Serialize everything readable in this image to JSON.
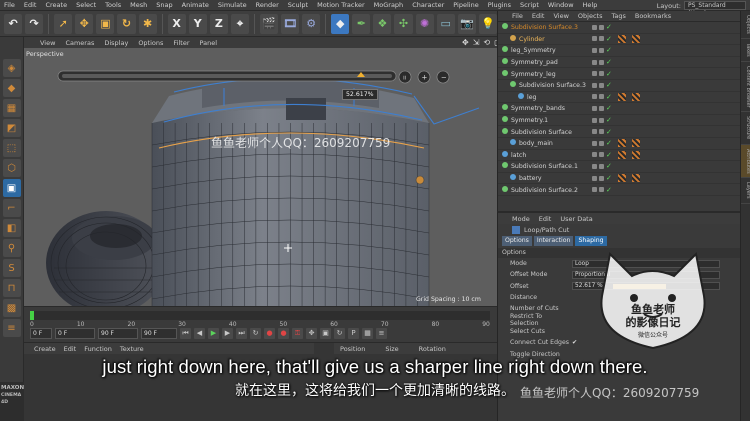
{
  "menubar": {
    "items": [
      "File",
      "Edit",
      "Create",
      "Select",
      "Tools",
      "Mesh",
      "Snap",
      "Animate",
      "Simulate",
      "Render",
      "Sculpt",
      "Motion Tracker",
      "MoGraph",
      "Character",
      "Pipeline",
      "Plugins",
      "Script",
      "Window",
      "Help"
    ],
    "layout_label": "Layout:",
    "layout_value": "PS_Standard (User)"
  },
  "toolbar": {
    "axis_x": "X",
    "axis_y": "Y",
    "axis_z": "Z"
  },
  "viewport": {
    "menu": [
      "View",
      "Cameras",
      "Display",
      "Options",
      "Filter",
      "Panel"
    ],
    "name": "Perspective",
    "zoom_tooltip": "52.617%",
    "grid_spacing": "Grid Spacing : 10 cm"
  },
  "timeline": {
    "ticks": [
      "0",
      "10",
      "20",
      "30",
      "40",
      "50",
      "60",
      "70",
      "80",
      "90"
    ],
    "frame_start": "0 F",
    "frame_current": "0 F",
    "frame_end": "90 F",
    "frame_preview_end": "90 F"
  },
  "bottom": {
    "menu": [
      "Create",
      "Edit",
      "Function",
      "Texture"
    ],
    "coord_headers": [
      "Position",
      "Size",
      "Rotation"
    ]
  },
  "brand": {
    "line1": "MAXON",
    "line2": "CINEMA 4D"
  },
  "object_manager": {
    "menu": [
      "File",
      "Edit",
      "View",
      "Objects",
      "Tags",
      "Bookmarks"
    ],
    "objects": [
      {
        "name": "Subdivision Surface.3",
        "indent": 0,
        "color": "#6fc86f",
        "selected": true,
        "tags": 0
      },
      {
        "name": "Cylinder",
        "indent": 1,
        "color": "#d2a24c",
        "selected": false,
        "tags": 2
      },
      {
        "name": "leg_Symmetry",
        "indent": 0,
        "color": "#6fc86f",
        "selected": false,
        "tags": 0
      },
      {
        "name": "Symmetry_pad",
        "indent": 0,
        "color": "#6fc86f",
        "selected": false,
        "tags": 0
      },
      {
        "name": "Symmetry_leg",
        "indent": 0,
        "color": "#6fc86f",
        "selected": false,
        "tags": 0
      },
      {
        "name": "Subdivision Surface.3",
        "indent": 1,
        "color": "#6fc86f",
        "selected": false,
        "tags": 0
      },
      {
        "name": "leg",
        "indent": 2,
        "color": "#5aa0d8",
        "selected": false,
        "tags": 2
      },
      {
        "name": "Symmetry_bands",
        "indent": 0,
        "color": "#6fc86f",
        "selected": false,
        "tags": 0
      },
      {
        "name": "Symmetry.1",
        "indent": 0,
        "color": "#6fc86f",
        "selected": false,
        "tags": 0
      },
      {
        "name": "Subdivision Surface",
        "indent": 0,
        "color": "#6fc86f",
        "selected": false,
        "tags": 0
      },
      {
        "name": "body_main",
        "indent": 1,
        "color": "#5aa0d8",
        "selected": false,
        "tags": 2
      },
      {
        "name": "latch",
        "indent": 0,
        "color": "#5aa0d8",
        "selected": false,
        "tags": 2
      },
      {
        "name": "Subdivision Surface.1",
        "indent": 0,
        "color": "#6fc86f",
        "selected": false,
        "tags": 0
      },
      {
        "name": "battery",
        "indent": 1,
        "color": "#5aa0d8",
        "selected": false,
        "tags": 2
      },
      {
        "name": "Subdivision Surface.2",
        "indent": 0,
        "color": "#6fc86f",
        "selected": false,
        "tags": 0
      }
    ]
  },
  "attribute_manager": {
    "menu": [
      "Mode",
      "Edit",
      "User Data"
    ],
    "title": "Loop/Path Cut",
    "tabs": [
      "Options",
      "Interaction",
      "Shaping"
    ],
    "section": "Options",
    "rows": [
      {
        "label": "Mode",
        "value": "Loop"
      },
      {
        "label": "Offset Mode",
        "value": "Proportional"
      },
      {
        "label": "Offset",
        "value": "52.617 %"
      },
      {
        "label": "Distance",
        "value": ""
      },
      {
        "label": "Number of Cuts",
        "value": ""
      },
      {
        "label": "Restrict To Selection",
        "value": ""
      },
      {
        "label": "Select Cuts",
        "value": ""
      },
      {
        "label": "Connect Cut Edges",
        "value": "✔"
      },
      {
        "label": "Toggle Direction",
        "value": ""
      }
    ],
    "offset_fraction": 0.526
  },
  "right_strip": [
    "Objects",
    "Takes",
    "Content Browser",
    "Structure",
    "Attributes",
    "Layers"
  ],
  "subtitles": {
    "en": "just right down here, that'll give us a sharper line right down there.",
    "cn": "就在这里，这将给我们一个更加清晰的线路。"
  },
  "watermarks": {
    "qq_top": "鱼鱼老师个人QQ：2609207759",
    "qq_bottom": "鱼鱼老师个人QQ：2609207759",
    "stamp_line1": "鱼鱼老师",
    "stamp_line2": "的影像日记",
    "stamp_line3": "微信公众号"
  },
  "colors": {
    "accent_blue": "#2d6aa3",
    "selection_orange": "#d88a2a",
    "check_green": "#5bd35b"
  }
}
